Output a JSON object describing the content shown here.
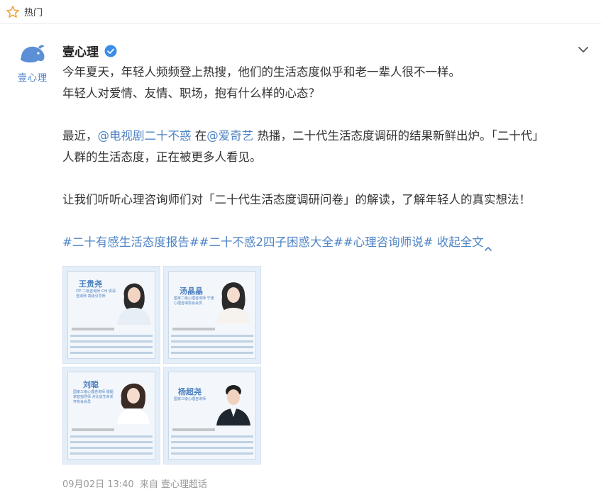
{
  "topbar": {
    "label": "热门"
  },
  "post": {
    "brand_text": "壹心理",
    "author": "壹心理",
    "paragraphs": [
      "今年夏天，年轻人频频登上热搜，他们的生活态度似乎和老一辈人很不一样。",
      "年轻人对爱情、友情、职场，抱有什么样的心态？"
    ],
    "para2_prefix": "最近，",
    "mention1": "@电视剧二十不惑",
    "para2_mid1": " 在",
    "mention2": "@爱奇艺",
    "para2_mid2": " 热播，二十代生活态度调研的结果新鲜出炉。「二十代」",
    "para2_line2": "人群的生活态度，正在被更多人看见。",
    "para3": "让我们听听心理咨询师们对「二十代生活态度调研问卷」的解读，了解年轻人的真实想法！",
    "tag1": "#二十有感生活态度报告#",
    "tag2": "#二十不惑2四子困惑大全#",
    "tag3": "#心理咨询师说#",
    "collapse": " 收起全文",
    "images": [
      {
        "name": "王贵尧",
        "title": "ITP 二级咨询师 CHI 资深咨询师 高级引导师"
      },
      {
        "name": "汤晶晶",
        "title": "国家二级心理咨询师 宁波心理咨询协会会员"
      },
      {
        "name": "刘聪",
        "title": "国家三级心理咨询师 婚姻家庭指导师 河北省生命关怀协会会员"
      },
      {
        "name": "杨超尧",
        "title": "国家三级心理咨询师"
      }
    ],
    "footer": {
      "time": "09月02日 13:40",
      "from": "来自",
      "source": "壹心理超话"
    }
  },
  "colors": {
    "link": "#4f84c4",
    "accent": "#4a7fc8",
    "verified": "#3a8ee6"
  },
  "icons": [
    "star-icon",
    "logo-icon",
    "verified-icon",
    "chevron-down-icon",
    "chevron-up-icon"
  ]
}
